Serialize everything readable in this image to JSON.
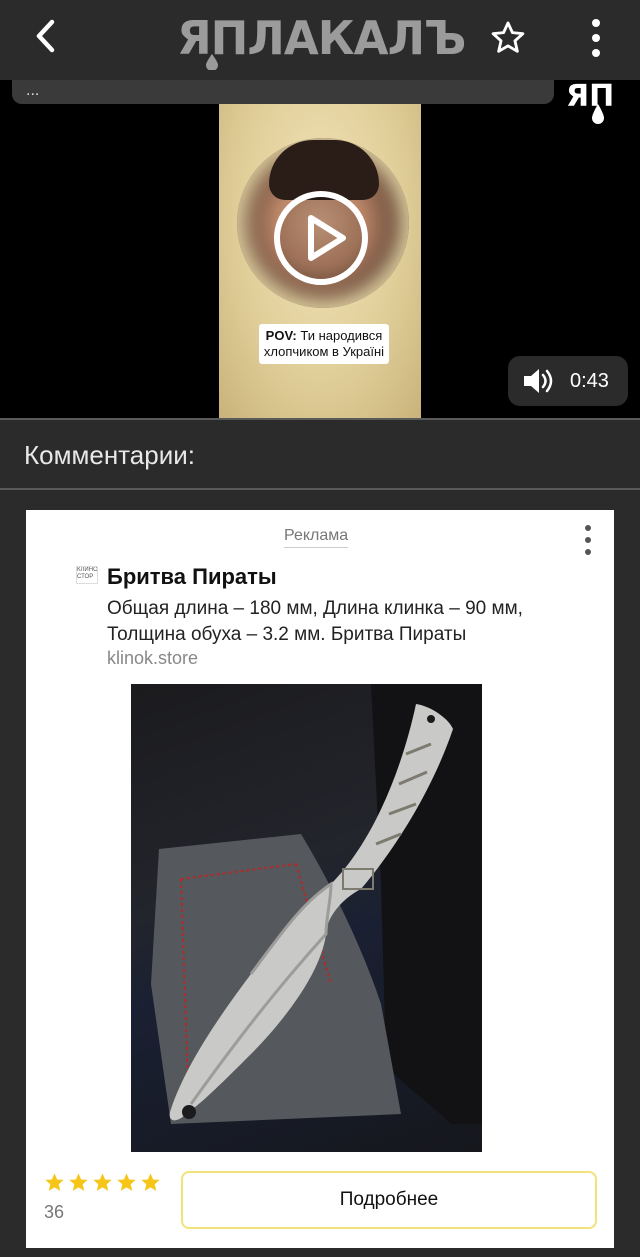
{
  "header": {
    "logo_text": "ЯПЛАКАЛЪ",
    "icons": [
      "back-arrow-icon",
      "star-icon",
      "more-vertical-icon"
    ]
  },
  "video": {
    "title_bar_text": "...",
    "caption_bold": "POV:",
    "caption_rest": " Ти народився хлопчиком в Україні",
    "duration": "0:43",
    "watermark_text": "ЯП",
    "icons": [
      "play-icon",
      "volume-icon"
    ]
  },
  "comments": {
    "header": "Комментарии:"
  },
  "ad": {
    "label": "Реклама",
    "title": "Бритва Пираты",
    "description": "Общая длина – 180 мм, Длина клинка – 90 мм, Толщина обуха – 3.2 мм. Бритва Пираты",
    "domain": "klinok.store",
    "favicon_text": "КЛИНОК СТОР",
    "rating_count": "36",
    "rating_stars": 5,
    "button_label": "Подробнее",
    "accent_color": "#f5c518"
  },
  "colors": {
    "background": "#2b2b2b",
    "logo": "#9b9b9b",
    "star": "#f5c518",
    "button_border": "#f2e27a"
  }
}
